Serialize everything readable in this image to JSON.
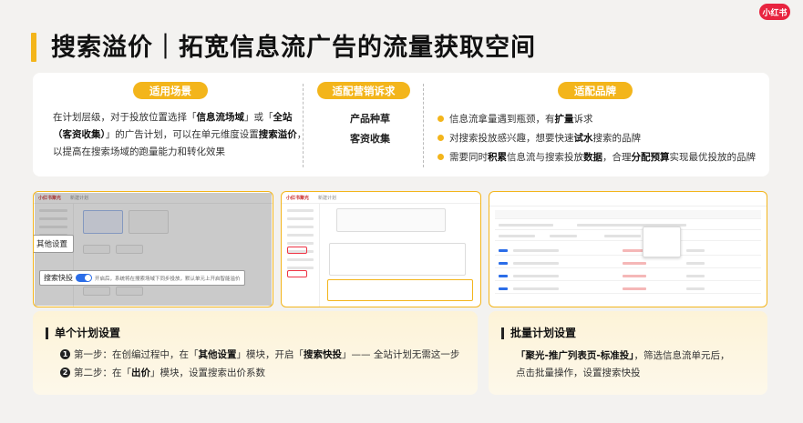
{
  "brand": {
    "logo_text": "小红书"
  },
  "page": {
    "title": "搜索溢价｜拓宽信息流广告的流量获取空间"
  },
  "scenario": {
    "label": "适用场景",
    "parts": [
      "在计划层级，对于投放位置选择「",
      "信息流场域",
      "」或「",
      "全站（客资收集）",
      "」的广告计划，可以在单元维度设置",
      "搜索溢价",
      "，以提高在搜索场域的跑量能力和转化效果"
    ]
  },
  "marketing": {
    "label": "适配营销诉求",
    "items": [
      "产品种草",
      "客资收集"
    ]
  },
  "brand_fit": {
    "label": "适配品牌",
    "rows": [
      {
        "a": "信息流拿量遇到瓶颈，有",
        "b": "扩量",
        "c": "诉求",
        "d": "",
        "e": "",
        "f": "",
        "g": ""
      },
      {
        "a": "对搜索投放感兴趣，想要快速",
        "b": "试水",
        "c": "搜索的品牌",
        "d": "",
        "e": "",
        "f": "",
        "g": ""
      },
      {
        "a": "需要同时",
        "b": "积累",
        "c": "信息流与搜索投放",
        "d": "数据",
        "e": "，合理",
        "f": "分配预算",
        "g": "实现最优投放的品牌"
      }
    ]
  },
  "screenshots": {
    "s1": {
      "brand": "小红书聚光",
      "tab": "新建计划",
      "callout_other": "其他设置",
      "callout_search_label": "搜索快投",
      "callout_search_desc": "开启后，系统将在搜索场域下同步投放，默认单元上开启智能溢价"
    },
    "s2": {
      "brand": "小红书聚光",
      "tab": "新建计划"
    }
  },
  "single_plan": {
    "title": "单个计划设置",
    "step1": {
      "num": "1",
      "a": "第一步：在创编过程中，在「",
      "b": "其他设置",
      "c": "」模块，开启「",
      "d": "搜索快投",
      "e": "」—— 全站计划无需这一步"
    },
    "step2": {
      "num": "2",
      "a": "第二步：在「",
      "b": "出价",
      "c": "」模块，设置搜索出价系数"
    }
  },
  "batch_plan": {
    "title": "批量计划设置",
    "line1_bold": "「聚光-推广列表页-标准投」",
    "line1_rest": "，筛选信息流单元后，",
    "line2": "点击批量操作，设置搜索快投"
  },
  "colors": {
    "accent": "#f3b51b",
    "brand_red": "#e8243f",
    "toggle_blue": "#2b6de8"
  }
}
